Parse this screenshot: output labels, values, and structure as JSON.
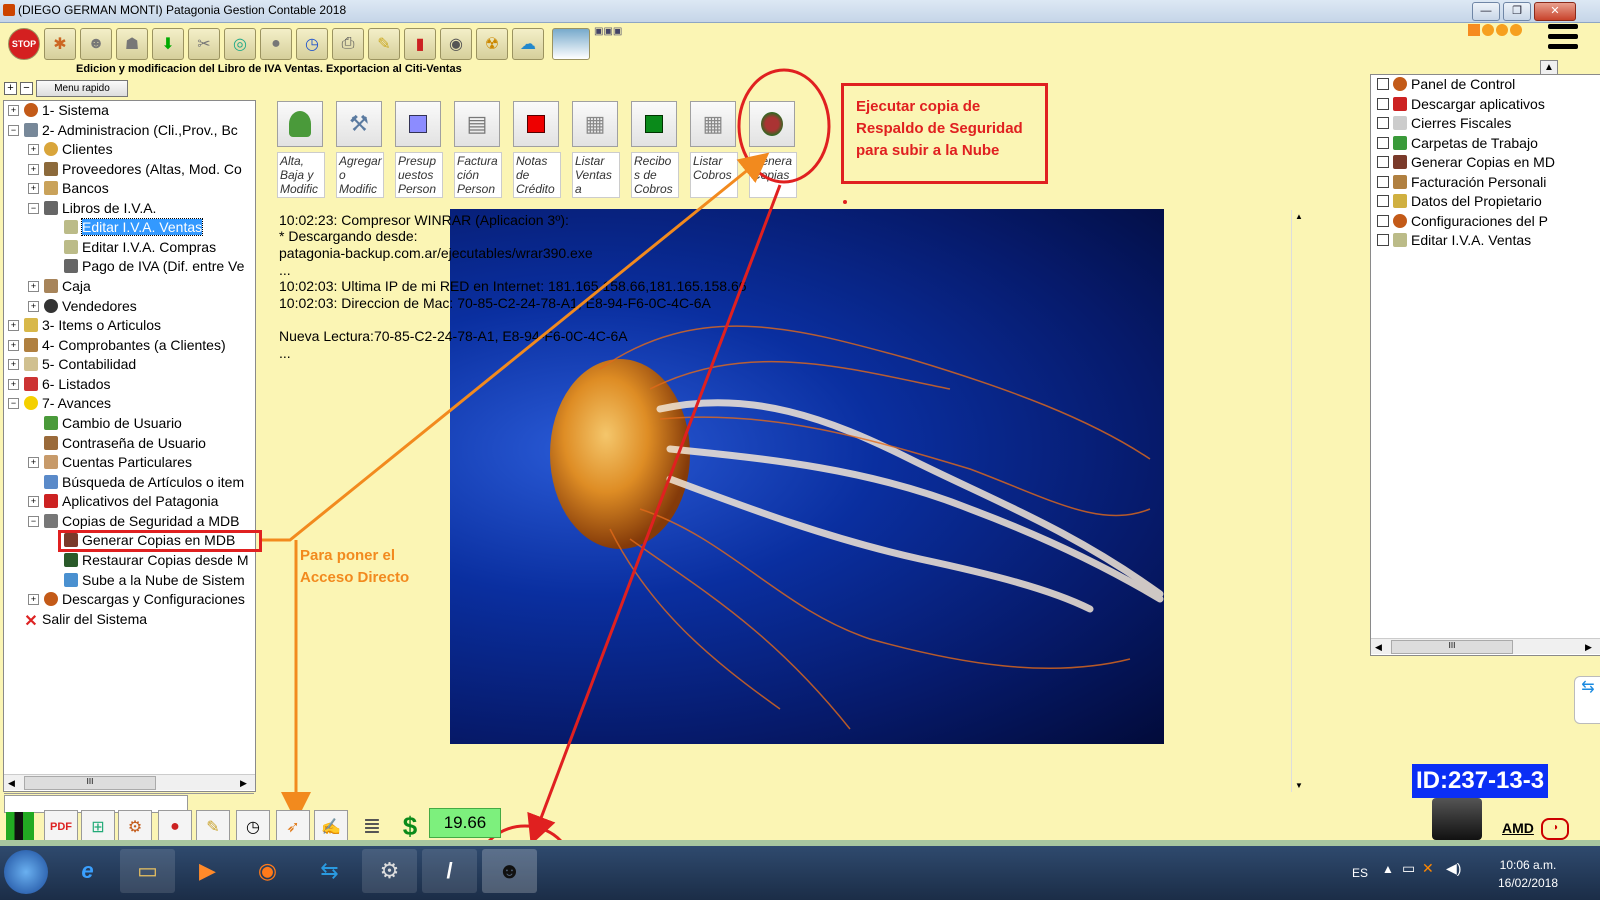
{
  "window": {
    "title": "(DIEGO GERMAN MONTI) Patagonia Gestion Contable 2018",
    "subtitle": "Edicion y modificacion del Libro de IVA Ventas. Exportacion al Citi-Ventas"
  },
  "left_panel": {
    "menu_button": "Menu rapido",
    "tree": [
      {
        "label": "1- Sistema",
        "level": 0
      },
      {
        "label": "2- Administracion (Cli.,Prov., Bc",
        "level": 0
      },
      {
        "label": "Clientes",
        "level": 1
      },
      {
        "label": "Proveedores (Altas, Mod. Co",
        "level": 1
      },
      {
        "label": "Bancos",
        "level": 1
      },
      {
        "label": "Libros de I.V.A.",
        "level": 1
      },
      {
        "label": "Editar I.V.A. Ventas",
        "level": 2,
        "selected": true
      },
      {
        "label": "Editar I.V.A. Compras",
        "level": 2
      },
      {
        "label": "Pago de IVA (Dif. entre Ve",
        "level": 2
      },
      {
        "label": "Caja",
        "level": 1
      },
      {
        "label": "Vendedores",
        "level": 1
      },
      {
        "label": "3- Items o Articulos",
        "level": 0
      },
      {
        "label": "4- Comprobantes (a Clientes)",
        "level": 0
      },
      {
        "label": "5- Contabilidad",
        "level": 0
      },
      {
        "label": "6- Listados",
        "level": 0
      },
      {
        "label": "7- Avances",
        "level": 0
      },
      {
        "label": "Cambio de Usuario",
        "level": 1
      },
      {
        "label": "Contraseña de Usuario",
        "level": 1
      },
      {
        "label": "Cuentas Particulares",
        "level": 1
      },
      {
        "label": "Búsqueda de Artículos o item",
        "level": 1
      },
      {
        "label": "Aplicativos del Patagonia",
        "level": 1
      },
      {
        "label": "Copias de Seguridad a MDB",
        "level": 1
      },
      {
        "label": "Generar Copias en MDB",
        "level": 2
      },
      {
        "label": "Restaurar Copias desde M",
        "level": 2
      },
      {
        "label": "Sube a la Nube de Sistem",
        "level": 2
      },
      {
        "label": "Descargas y Configuraciones",
        "level": 1
      },
      {
        "label": "Salir del Sistema",
        "level": 0
      }
    ],
    "scroll_glyph": "III"
  },
  "modules": [
    {
      "label": "Alta, Baja y Modific",
      "icon": "person-icon"
    },
    {
      "label": "Agregar o Modific",
      "icon": "tools-icon"
    },
    {
      "label": "Presup uestos Person",
      "icon": "blue-square-icon"
    },
    {
      "label": "Factura ción Person",
      "icon": "cash-register-icon"
    },
    {
      "label": "Notas de Crédito",
      "icon": "red-square-icon"
    },
    {
      "label": "Listar Ventas a",
      "icon": "list-icon"
    },
    {
      "label": "Recibo s de Cobros",
      "icon": "green-square-icon"
    },
    {
      "label": "Listar Cobros",
      "icon": "list-icon"
    },
    {
      "label": "Genera Copias",
      "icon": "backup-icon"
    }
  ],
  "log": [
    "10:02:23: Compresor WINRAR (Aplicacion 3º):",
    "* Descargando desde:",
    "patagonia-backup.com.ar/ejecutables/wrar390.exe",
    "...",
    "10:02:03: Ultima IP de mi RED en Internet: 181.165.158.66,181.165.158.66",
    "10:02:03: Direccion de Mac: 70-85-C2-24-78-A1, E8-94-F6-0C-4C-6A",
    "",
    "Nueva Lectura:70-85-C2-24-78-A1, E8-94-F6-0C-4C-6A",
    "..."
  ],
  "right_panel": {
    "items": [
      "Panel de Control",
      "Descargar aplicativos",
      "Cierres Fiscales",
      "Carpetas de Trabajo",
      "Generar Copias en MD",
      "Facturación Personali",
      "Datos del Propietario",
      "Configuraciones del P",
      "Editar I.V.A. Ventas"
    ],
    "scroll_glyph": "III"
  },
  "annotations": {
    "red_text": "Ejecutar copia de Respaldo de Seguridad para subir a la Nube",
    "orange_text": "Para poner el Acceso Directo",
    "red_color": "#e02020",
    "orange_color": "#f28a1e"
  },
  "bottom": {
    "value_box": "19.66",
    "id_badge": "ID:237-13-3",
    "brand": "AMD"
  },
  "taskbar": {
    "language": "ES",
    "time": "10:06 a.m.",
    "date": "16/02/2018"
  }
}
